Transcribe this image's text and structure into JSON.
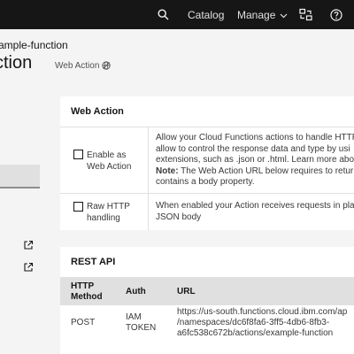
{
  "nav": {
    "catalog": "Catalog",
    "manage": "Manage"
  },
  "header": {
    "breadcrumb": "ample-function",
    "title": "ction",
    "tag": "Web Action"
  },
  "web_action_card": {
    "title": "Web Action",
    "enable_label_line1": "Enable as",
    "enable_label_line2": "Web Action",
    "enable_desc_line1": "Allow your Cloud Functions actions to handle HTTP",
    "enable_desc_line2": "allow to control the response data and type by usi",
    "enable_desc_line3": "extensions, such as .json or .html. Learn more abo",
    "enable_desc_note_label": "Note:",
    "enable_desc_note_text": " The Web Action URL below requires to retur",
    "enable_desc_line5": "contains a body property.",
    "raw_label_line1": "Raw HTTP",
    "raw_label_line2": "handling",
    "raw_desc_line1": "When enabled your Action receives requests in pla",
    "raw_desc_line2": "JSON body"
  },
  "rest_api_card": {
    "title": "REST API",
    "columns": {
      "method_line1": "HTTP",
      "method_line2": "Method",
      "auth": "Auth",
      "url": "URL"
    },
    "row": {
      "method": "POST",
      "auth_line1": "IAM",
      "auth_line2": "TOKEN",
      "url_line1": "https://us-south.functions.cloud.ibm.com/ap",
      "url_line2": "/namespaces/dc6f8fa6-3ff5-4db6-8fb3-",
      "url_line3": "a6fc538c672b/actions/example-function"
    }
  }
}
